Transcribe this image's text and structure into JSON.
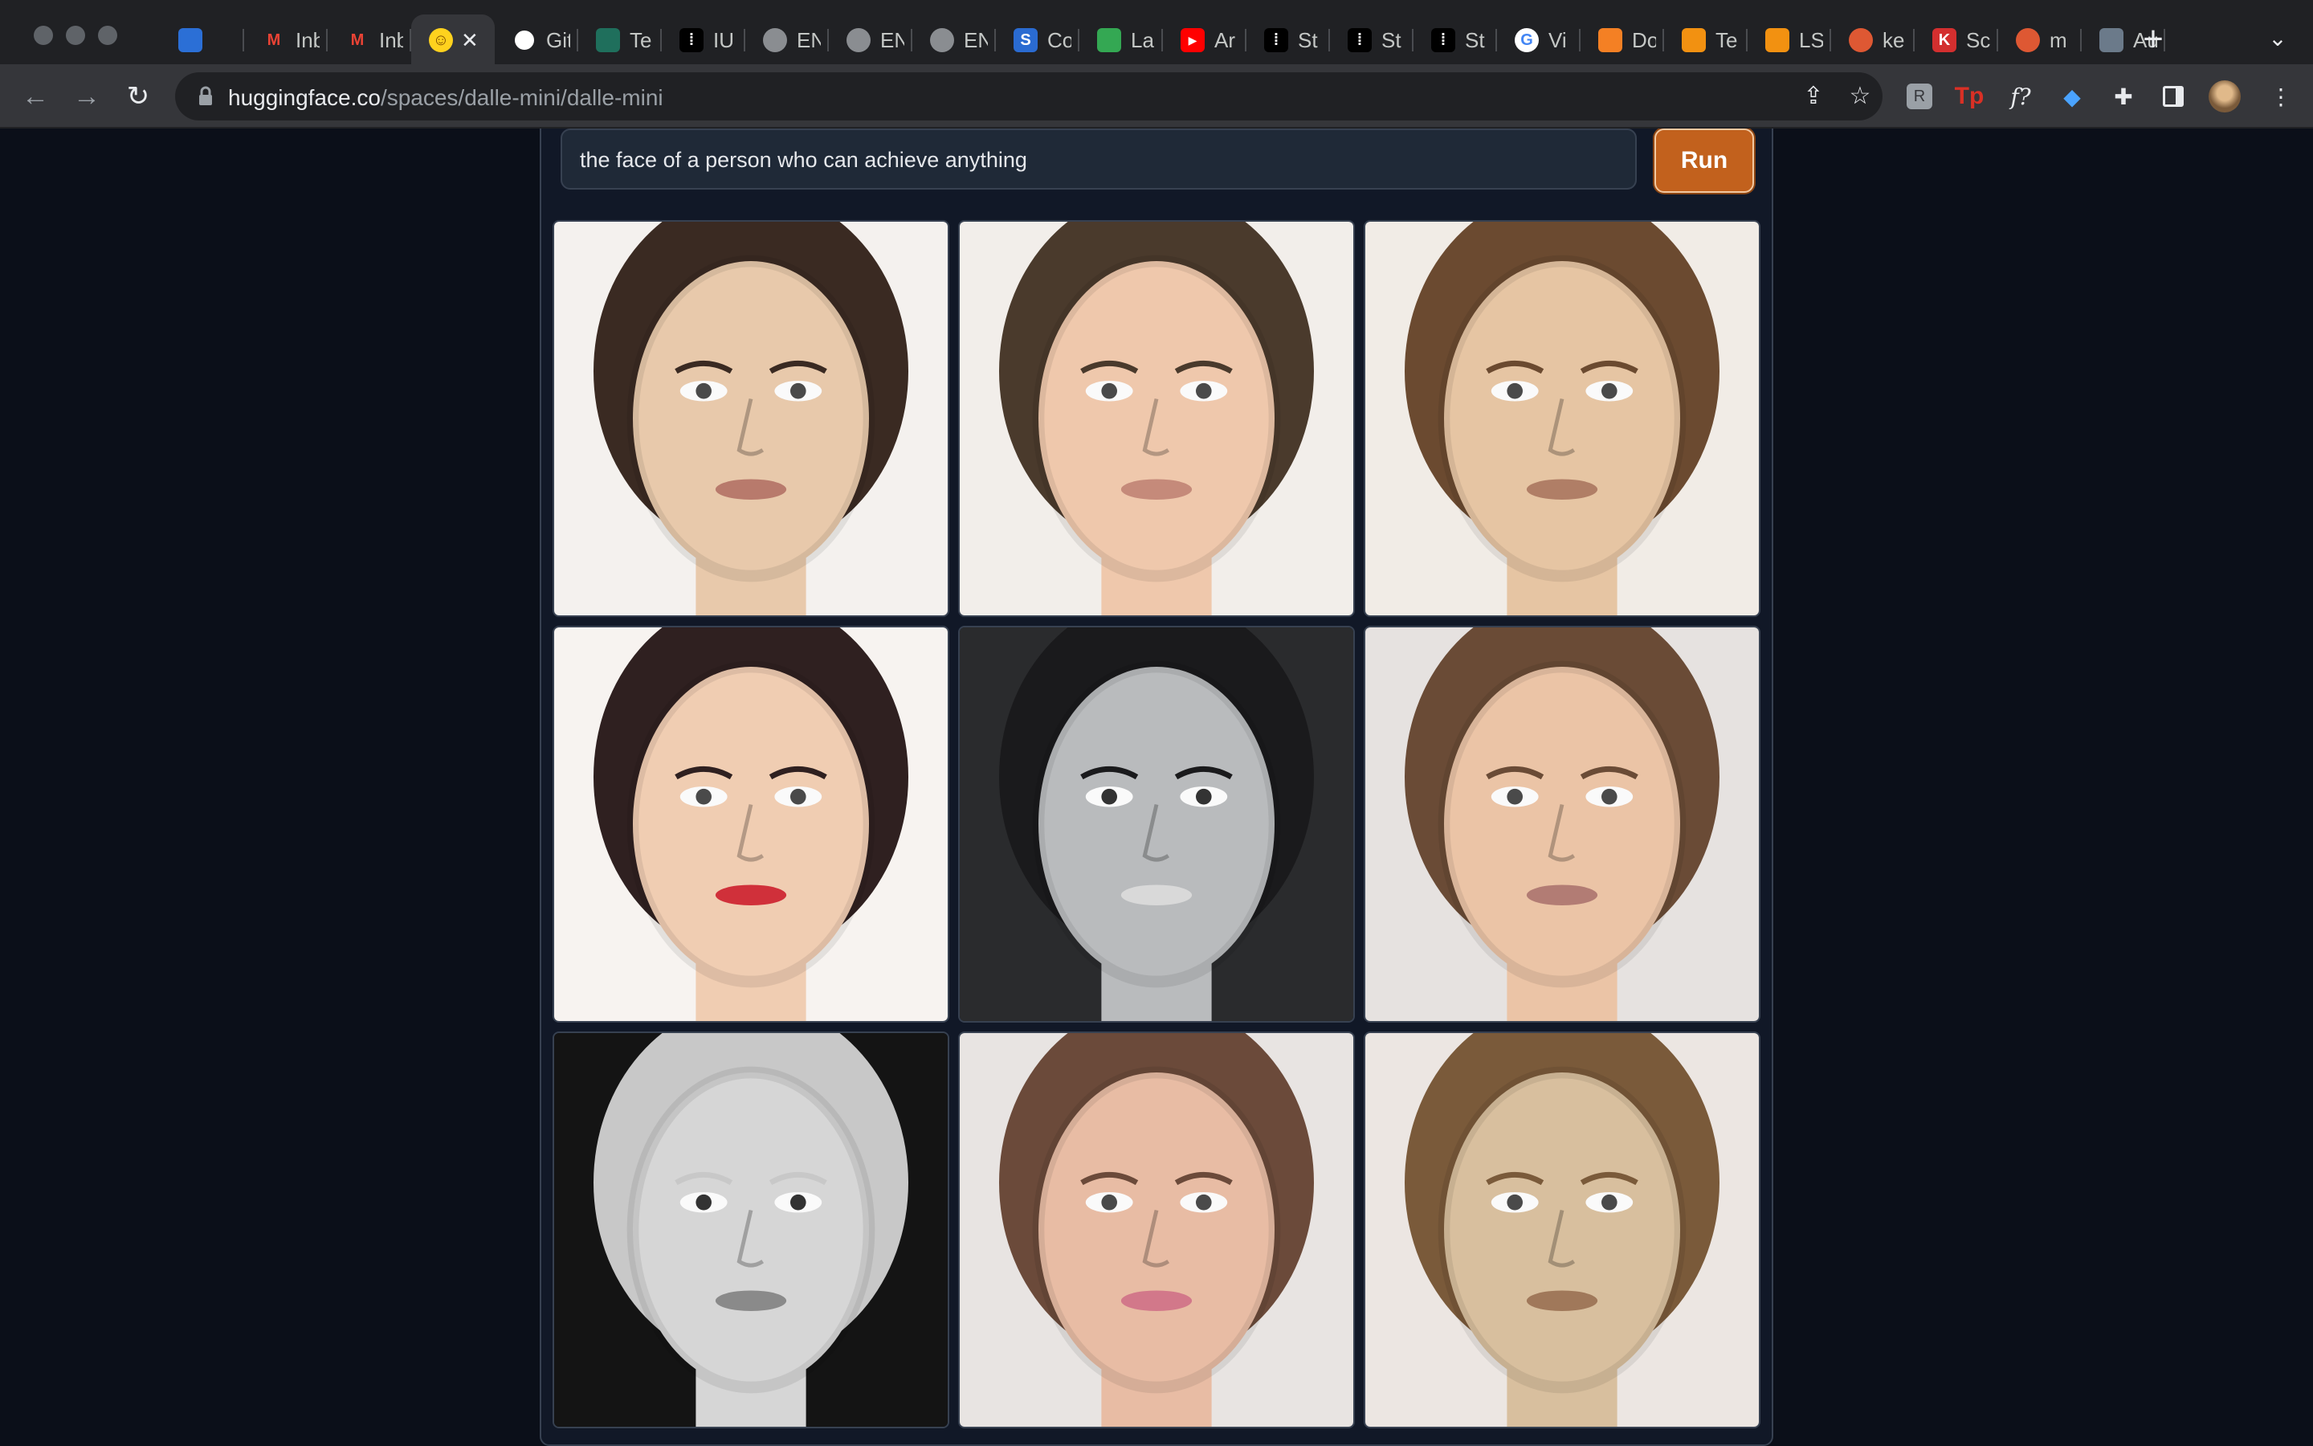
{
  "browser": {
    "tabs": [
      {
        "label": "",
        "icon": "sapphire-gem-icon",
        "color": "#2b6fd6"
      },
      {
        "label": "Inbox",
        "icon": "gmail-icon",
        "color": "#ea4335"
      },
      {
        "label": "Inbox",
        "icon": "gmail-icon",
        "color": "#ea4335"
      },
      {
        "label": "",
        "icon": "hugging-face-icon",
        "color": "#ffd21e",
        "active": true
      },
      {
        "label": "GitHub",
        "icon": "github-icon",
        "color": "#ffffff"
      },
      {
        "label": "Te",
        "icon": "teal-leaf-icon",
        "color": "#1f6f5c"
      },
      {
        "label": "IU",
        "icon": "black-dots-icon",
        "color": "#000000"
      },
      {
        "label": "EN",
        "icon": "globe-icon",
        "color": "#8a8d91"
      },
      {
        "label": "EN",
        "icon": "globe-icon",
        "color": "#8a8d91"
      },
      {
        "label": "EN",
        "icon": "globe-icon",
        "color": "#8a8d91"
      },
      {
        "label": "Co",
        "icon": "s-logo-icon",
        "color": "#2a6bd1"
      },
      {
        "label": "La",
        "icon": "green-robot-icon",
        "color": "#34a853"
      },
      {
        "label": "Ar",
        "icon": "youtube-icon",
        "color": "#ff0000"
      },
      {
        "label": "St",
        "icon": "black-dots-icon",
        "color": "#000000"
      },
      {
        "label": "St",
        "icon": "black-dots-icon",
        "color": "#000000"
      },
      {
        "label": "St",
        "icon": "black-dots-icon",
        "color": "#000000"
      },
      {
        "label": "Vi",
        "icon": "google-icon",
        "color": "#4285f4"
      },
      {
        "label": "Do",
        "icon": "orange-arc-icon",
        "color": "#f48024"
      },
      {
        "label": "Te",
        "icon": "orange-book-icon",
        "color": "#f29111"
      },
      {
        "label": "LS",
        "icon": "orange-book-icon",
        "color": "#f29111"
      },
      {
        "label": "ke",
        "icon": "duckduckgo-icon",
        "color": "#de5833"
      },
      {
        "label": "Sc",
        "icon": "k-logo-icon",
        "color": "#d32f2f"
      },
      {
        "label": "m",
        "icon": "duckduckgo-icon",
        "color": "#de5833"
      },
      {
        "label": "Au",
        "icon": "picture-icon",
        "color": "#6b7a8a"
      }
    ],
    "url_host": "huggingface.co",
    "url_path": "/spaces/dalle-mini/dalle-mini"
  },
  "app": {
    "prompt_text": "the face of a person who can achieve anything",
    "run_label": "Run",
    "accent": "#c2611d"
  },
  "gallery": [
    {
      "name": "generated-image-1",
      "bg": "#f4f1ee",
      "skin": "#e8c9ab",
      "hair": "#3a2a22",
      "lips": "#b87a6c",
      "dark": false
    },
    {
      "name": "generated-image-2",
      "bg": "#f2eeea",
      "skin": "#efc8ac",
      "hair": "#4a3a2c",
      "lips": "#c58a7a",
      "dark": false
    },
    {
      "name": "generated-image-3",
      "bg": "#f1ece6",
      "skin": "#e6c5a3",
      "hair": "#6b4a30",
      "lips": "#b07e66",
      "dark": false
    },
    {
      "name": "generated-image-4",
      "bg": "#f7f3f0",
      "skin": "#f0cdb2",
      "hair": "#2f2020",
      "lips": "#d0303a",
      "dark": false
    },
    {
      "name": "generated-image-5",
      "bg": "#2a2b2d",
      "skin": "#b9bbbd",
      "hair": "#1a1a1c",
      "lips": "#d9d9d9",
      "dark": true
    },
    {
      "name": "generated-image-6",
      "bg": "#e6e2e0",
      "skin": "#ebc4a6",
      "hair": "#6a4b36",
      "lips": "#b27c74",
      "dark": false
    },
    {
      "name": "generated-image-7",
      "bg": "#141414",
      "skin": "#d6d6d6",
      "hair": "#c8c8c8",
      "lips": "#8a8a8a",
      "dark": true
    },
    {
      "name": "generated-image-8",
      "bg": "#e8e4e2",
      "skin": "#e8bca4",
      "hair": "#6b4a3a",
      "lips": "#d2788a",
      "dark": false
    },
    {
      "name": "generated-image-9",
      "bg": "#ece6e2",
      "skin": "#d8bf9e",
      "hair": "#7a5a3a",
      "lips": "#a0785a",
      "dark": false
    }
  ]
}
